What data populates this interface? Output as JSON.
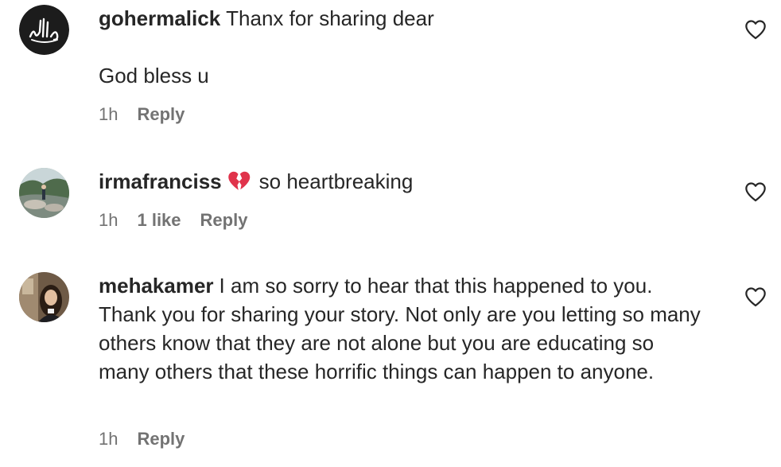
{
  "comments": [
    {
      "username": "gohermalick",
      "text": "Thanx for sharing dear",
      "text2": "God bless u",
      "time": "1h",
      "reply": "Reply"
    },
    {
      "username": "irmafranciss",
      "emoji": "broken-heart-icon",
      "text": "so heartbreaking",
      "time": "1h",
      "likes": "1 like",
      "reply": "Reply"
    },
    {
      "username": "mehakamer",
      "text": "I am so sorry to hear that this happened to you. Thank you for sharing your story. Not only are you letting so many others know that they are not alone but you are educating so many others that these horrific things can happen to anyone.",
      "time": "1h",
      "reply": "Reply"
    }
  ],
  "colors": {
    "text": "#262626",
    "secondary": "#737373",
    "emoji_red": "#e0334b"
  }
}
